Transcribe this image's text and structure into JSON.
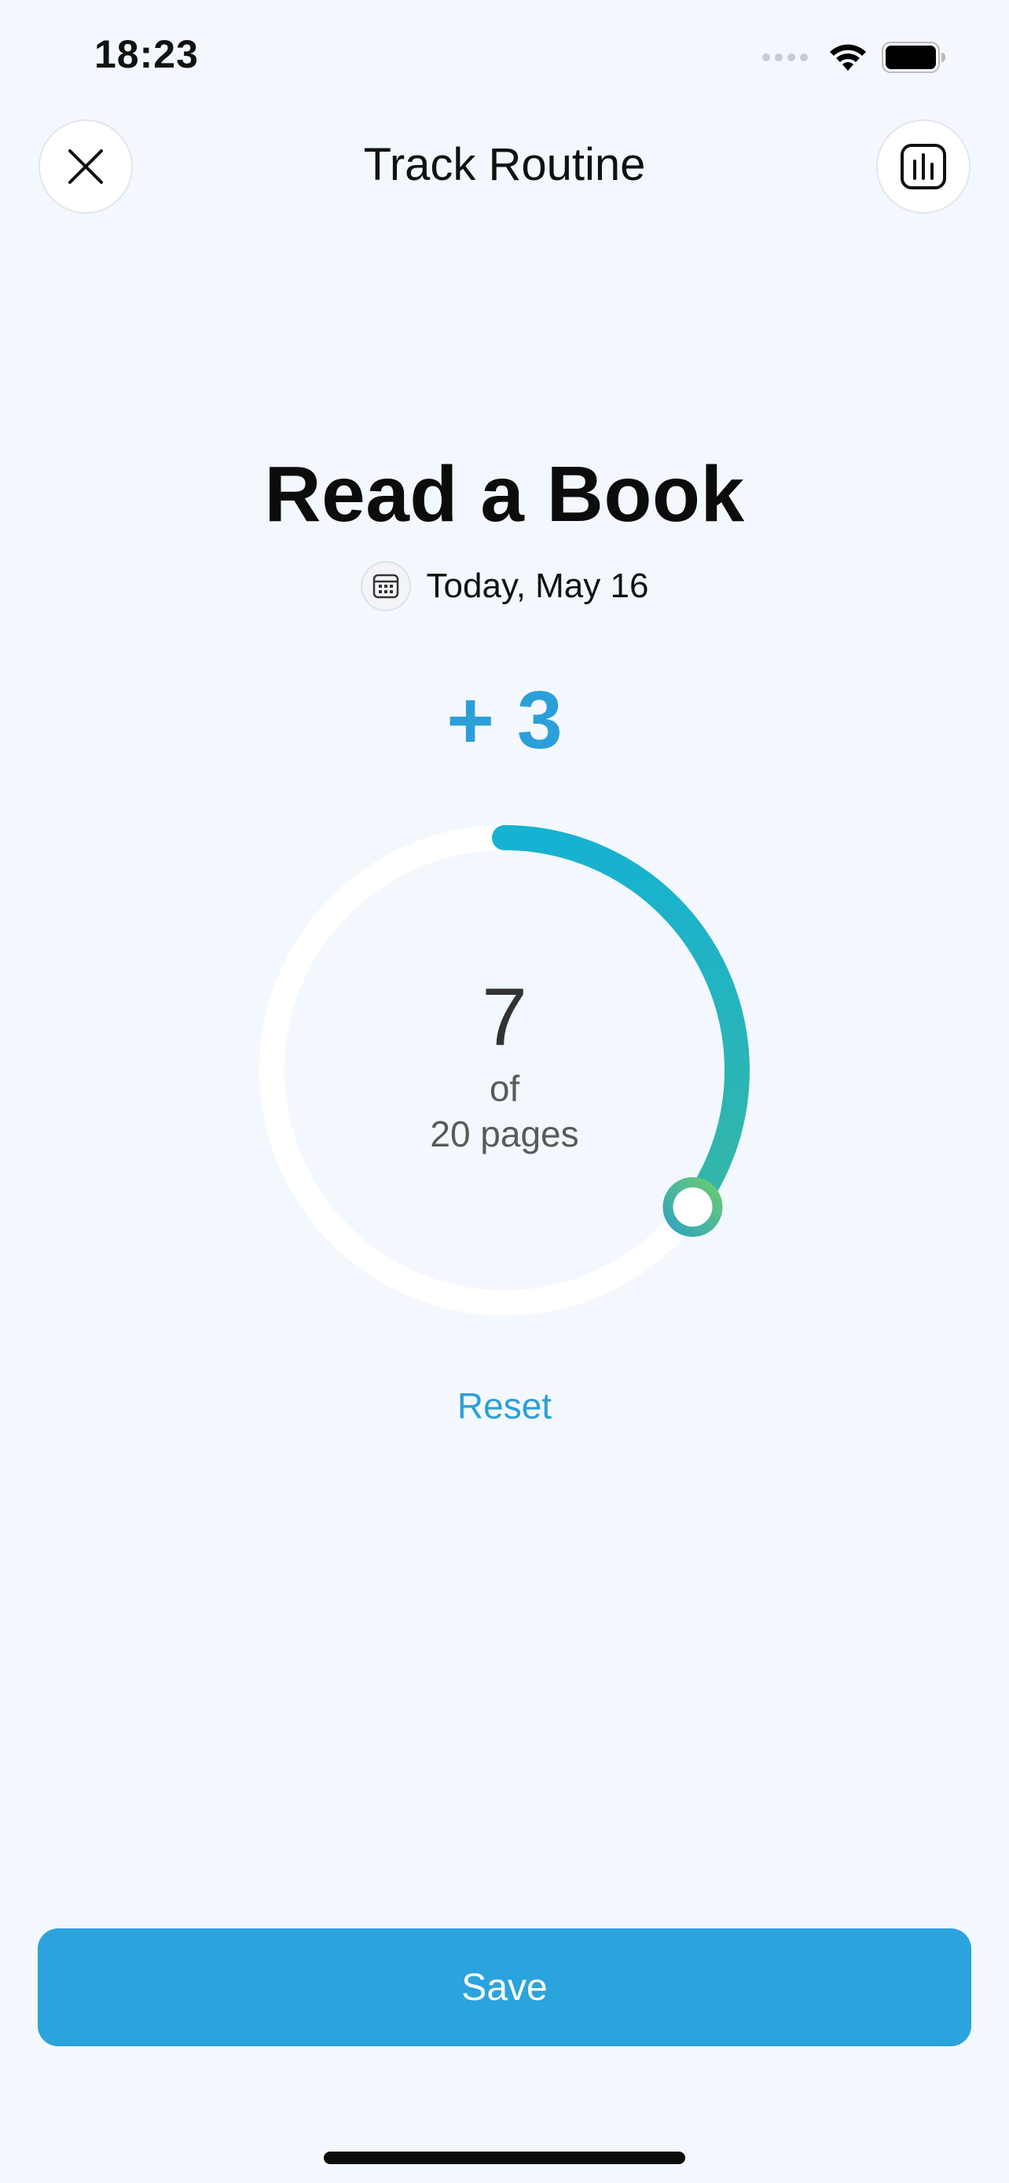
{
  "status_bar": {
    "time": "18:23",
    "icons": [
      "signal-dots-icon",
      "wifi-icon",
      "battery-icon"
    ]
  },
  "header": {
    "title": "Track Routine",
    "close_icon": "close-icon",
    "stats_icon": "bar-chart-icon"
  },
  "routine": {
    "name": "Read a Book",
    "date_icon": "calendar-icon",
    "date": "Today, May 16",
    "increment": "+ 3"
  },
  "progress": {
    "value": "7",
    "of_label": "of",
    "unit_label": "20 pages",
    "current": 7,
    "goal": 20,
    "colors": {
      "track": "#ffffff",
      "arc_start": "#16b2d2",
      "arc_end": "#35b6a6",
      "knob_ring_start": "#6fcf6a",
      "knob_ring_end": "#2ba0c8"
    }
  },
  "actions": {
    "reset_label": "Reset",
    "save_label": "Save"
  },
  "colors": {
    "accent": "#2ba3dc",
    "background": "#f3f8fe"
  }
}
